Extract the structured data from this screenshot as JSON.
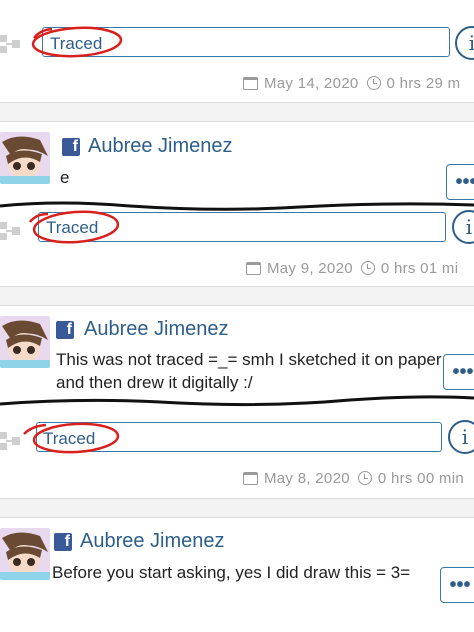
{
  "entries": [
    {
      "tag": "Traced",
      "date": "May 14, 2020",
      "duration": "0 hrs 29 m"
    },
    {
      "author": "Aubree Jimenez",
      "comment": "e",
      "tag": "Traced",
      "date": "May 9, 2020",
      "duration": "0 hrs 01 mi"
    },
    {
      "author": "Aubree Jimenez",
      "comment": "This was not traced =_= smh I sketched it on paper and then drew it digitally :/",
      "tag": "Traced",
      "date": "May 8, 2020",
      "duration": "0 hrs 00 min"
    },
    {
      "author": "Aubree Jimenez",
      "comment": "Before you start asking, yes I did draw this = 3="
    }
  ],
  "icons": {
    "facebook": "f",
    "info": "i",
    "more": "•••"
  },
  "colors": {
    "link_blue": "#2d5e8a",
    "facebook_blue": "#3a5998",
    "annotation_red": "#d8201c"
  }
}
